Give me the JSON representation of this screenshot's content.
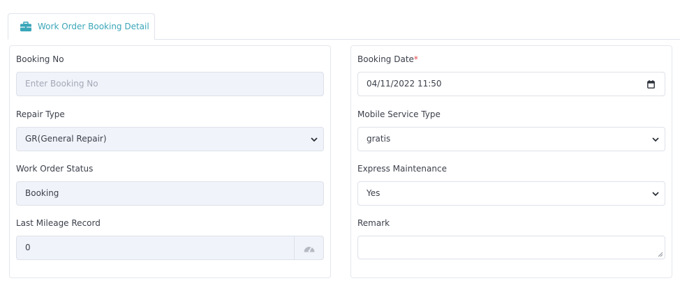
{
  "tab": {
    "label": "Work Order Booking Detail",
    "icon": "briefcase-icon",
    "color": "#3aa6b9"
  },
  "left": {
    "booking_no": {
      "label": "Booking No",
      "placeholder": "Enter Booking No",
      "value": ""
    },
    "repair_type": {
      "label": "Repair Type",
      "selected": "GR(General Repair)"
    },
    "work_order_status": {
      "label": "Work Order Status",
      "value": "Booking"
    },
    "last_mileage": {
      "label": "Last Mileage Record",
      "value": "0",
      "addon_icon": "speedometer-icon"
    }
  },
  "right": {
    "booking_date": {
      "label": "Booking Date",
      "required_mark": "*",
      "value": "04/11/2022 11:50",
      "icon": "calendar-icon"
    },
    "mobile_service_type": {
      "label": "Mobile Service Type",
      "selected": "gratis"
    },
    "express_maintenance": {
      "label": "Express Maintenance",
      "selected": "Yes"
    },
    "remark": {
      "label": "Remark",
      "value": ""
    }
  },
  "colors": {
    "input_bg": "#f1f3fa",
    "border": "#dde1e8",
    "required": "#e5484d"
  }
}
